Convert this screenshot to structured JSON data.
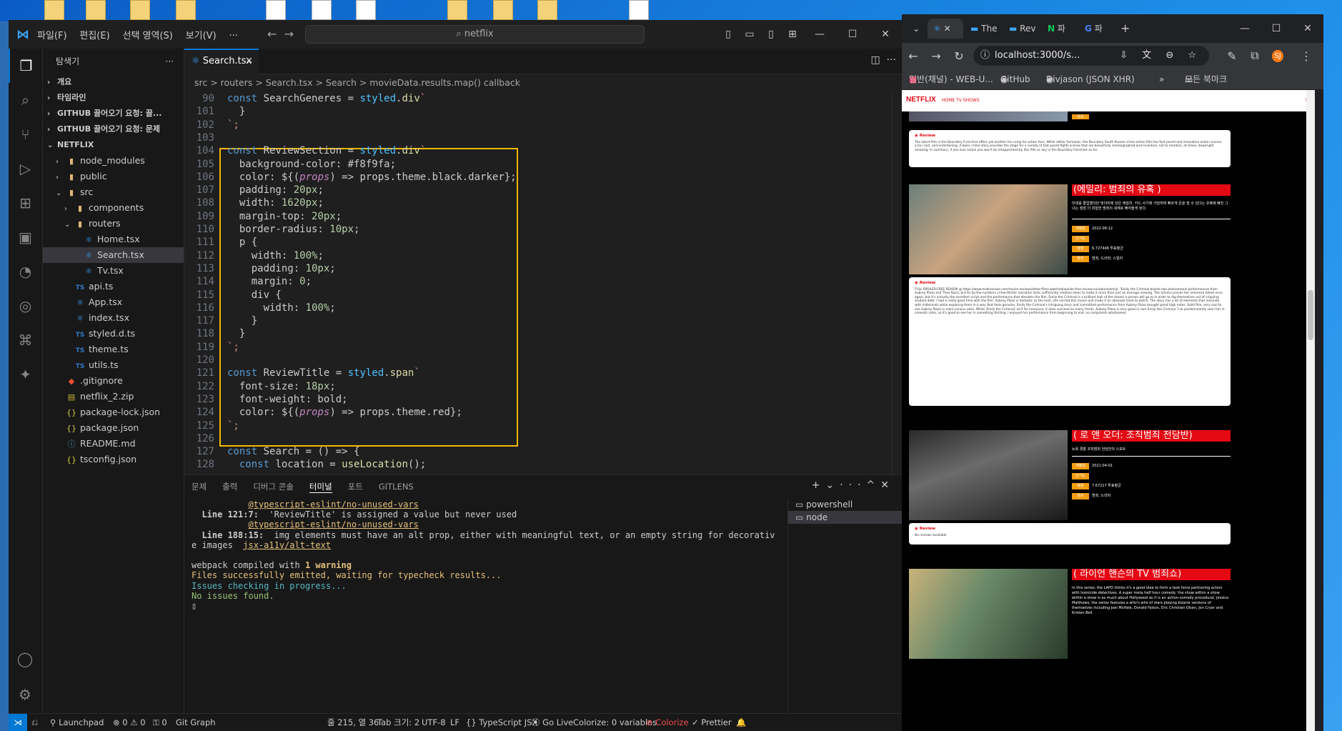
{
  "vscode": {
    "menu": [
      "파일(F)",
      "편집(E)",
      "선택 영역(S)",
      "보기(V)",
      "···"
    ],
    "command_center": "netflix",
    "explorer": {
      "title": "탐색기",
      "items": [
        {
          "label": "개요",
          "kind": "section"
        },
        {
          "label": "타임라인",
          "kind": "section"
        },
        {
          "label": "GITHUB 끌어오기 요청: 끌...",
          "kind": "section"
        },
        {
          "label": "GITHUB 끌어오기 요청: 문제",
          "kind": "section"
        },
        {
          "label": "NETFLIX",
          "kind": "section-open"
        },
        {
          "label": "node_modules",
          "kind": "folder"
        },
        {
          "label": "public",
          "kind": "folder"
        },
        {
          "label": "src",
          "kind": "folder-open"
        },
        {
          "label": "components",
          "kind": "folder"
        },
        {
          "label": "routers",
          "kind": "folder-open"
        },
        {
          "label": "Home.tsx",
          "kind": "tsx"
        },
        {
          "label": "Search.tsx",
          "kind": "tsx",
          "selected": true
        },
        {
          "label": "Tv.tsx",
          "kind": "tsx"
        },
        {
          "label": "api.ts",
          "kind": "ts"
        },
        {
          "label": "App.tsx",
          "kind": "tsx"
        },
        {
          "label": "index.tsx",
          "kind": "tsx"
        },
        {
          "label": "styled.d.ts",
          "kind": "ts"
        },
        {
          "label": "theme.ts",
          "kind": "ts"
        },
        {
          "label": "utils.ts",
          "kind": "ts"
        },
        {
          "label": ".gitignore",
          "kind": "git"
        },
        {
          "label": "netflix_2.zip",
          "kind": "zip"
        },
        {
          "label": "package-lock.json",
          "kind": "json"
        },
        {
          "label": "package.json",
          "kind": "json"
        },
        {
          "label": "README.md",
          "kind": "md"
        },
        {
          "label": "tsconfig.json",
          "kind": "json"
        }
      ]
    },
    "tab": {
      "label": "Search.tsx"
    },
    "breadcrumb": "src  >  routers  >  Search.tsx  >  Search  >  movieData.results.map() callback",
    "code": [
      {
        "n": "90",
        "t": "const SearchGeneres = styled.div`"
      },
      {
        "n": "101",
        "t": "  }"
      },
      {
        "n": "102",
        "t": "`;"
      },
      {
        "n": "103",
        "t": ""
      },
      {
        "n": "104",
        "t": "const ReviewSection = styled.div`"
      },
      {
        "n": "105",
        "t": "  background-color: #f8f9fa;"
      },
      {
        "n": "106",
        "t": "  color: ${(props) => props.theme.black.darker};"
      },
      {
        "n": "107",
        "t": "  padding: 20px;"
      },
      {
        "n": "108",
        "t": "  width: 1620px;"
      },
      {
        "n": "109",
        "t": "  margin-top: 20px;"
      },
      {
        "n": "110",
        "t": "  border-radius: 10px;"
      },
      {
        "n": "111",
        "t": "  p {"
      },
      {
        "n": "112",
        "t": "    width: 100%;"
      },
      {
        "n": "113",
        "t": "    padding: 10px;"
      },
      {
        "n": "114",
        "t": "    margin: 0;"
      },
      {
        "n": "115",
        "t": "    div {"
      },
      {
        "n": "116",
        "t": "      width: 100%;"
      },
      {
        "n": "117",
        "t": "    }"
      },
      {
        "n": "118",
        "t": "  }"
      },
      {
        "n": "119",
        "t": "`;"
      },
      {
        "n": "120",
        "t": ""
      },
      {
        "n": "121",
        "t": "const ReviewTitle = styled.span`"
      },
      {
        "n": "122",
        "t": "  font-size: 18px;"
      },
      {
        "n": "123",
        "t": "  font-weight: bold;"
      },
      {
        "n": "124",
        "t": "  color: ${(props) => props.theme.red};"
      },
      {
        "n": "125",
        "t": "`;"
      },
      {
        "n": "126",
        "t": ""
      },
      {
        "n": "127",
        "t": "const Search = () => {"
      },
      {
        "n": "128",
        "t": "  const location = useLocation();"
      }
    ],
    "panel_tabs": [
      "문제",
      "출력",
      "디버그 콘솔",
      "터미널",
      "포트",
      "GITLENS"
    ],
    "terminal": {
      "rule1": "@typescript-eslint/no-unused-vars",
      "line1_loc": "Line 121:7:",
      "line1_msg": "  'ReviewTitle' is assigned a value but never used",
      "rule2": "@typescript-eslint/no-unused-vars",
      "line2_loc": "Line 188:15:",
      "line2_msg": "  img elements must have an alt prop, either with meaningful text, or an empty string for decorativ",
      "line2_cont": "e images",
      "rule3": "jsx-a11y/alt-text",
      "webpack": "webpack compiled with ",
      "warning": "1 warning",
      "emitted": "Files successfully emitted, waiting for typecheck results...",
      "checking": "Issues checking in progress...",
      "none": "No issues found."
    },
    "terminal_list": [
      "powershell",
      "node"
    ],
    "status": {
      "launchpad": "Launchpad",
      "problems": "0 ⚠ 0",
      "ports": "0",
      "git_graph": "Git Graph",
      "cursor": "줄 215, 열 36",
      "tab_size": "Tab 크기: 2",
      "encoding": "UTF-8",
      "eol": "LF",
      "language": "TypeScript JSX",
      "golive": "Go Live",
      "colorize_vars": "Colorize: 0 variables",
      "colorize": "Colorize",
      "prettier": "Prettier"
    }
  },
  "chrome": {
    "tabs": [
      "The",
      "Rev",
      "파",
      "파"
    ],
    "url": "localhost:3000/s...",
    "bookmarks": [
      "일반(채널) - WEB-U...",
      "GitHub",
      "Divjason (JSON XHR)",
      "모든 북마크"
    ],
    "avatar": "SJ",
    "page": {
      "logo": "NETFLIX",
      "nav": "HOME   TV SHOWS",
      "movies": [
        {
          "title": "(에밀리: 범죄의 유혹 )",
          "overview": "미대를 졸업했지만 빚더미에 앉은 에밀리. 카드 사기에 가담하며 빠르게 돈을 벌 수 있다는 유혹에 빠진 그녀는 점점 더 위험한 범죄의 세계로 빠져들게 된다.",
          "labels": [
            "개봉일",
            "인기도",
            "평점",
            "장르"
          ],
          "values": [
            "2022-08-12",
            "",
            "6.727448 투표평균",
            "범죄, 드라마, 스릴러"
          ]
        },
        {
          "title": "( 로 앤 오더: 조직범죄 전담반)",
          "overview": "뉴욕 경찰 조직범죄 전담반의 스포트",
          "labels": [
            "개봉일",
            "인기도",
            "평점",
            "장르"
          ],
          "values": [
            "2021-04-01",
            "",
            "7.67217 투표평균",
            "범죄, 드라마"
          ]
        },
        {
          "title": "( 라이언 핸슨의 TV 범죄쇼)",
          "overview": "In this series, the LAPD thinks it's a good idea to form a task force partnering actors with homicide detectives. A super meta half hour comedy, the show within a show within a show is as much about Hollywood as it is an action-comedy procedural. Jessica Matthews, the series features a who's who of stars playing bizarre versions of themselves including Joel McHale, Donald Faison, Eric Christian Olsen, Jon Cryer and Kristen Bell.",
          "labels": [],
          "values": []
        }
      ],
      "reviews": [
        {
          "label": "Review",
          "text": "The latest film in the Boundary Franchise offers yet another fun romp for action fans. While rather formulaic, the Boundary South Korean crime action film has fast paced and innovative action scenes, a fun cast, and entertaining. A basic crime story provides the stage for a variety of fast paced fights scenes that are beautifully choreographed and inventive, not to mention, at times, downright amazing. In summary, if you love action you won't be disappointed by this film or any in the Boundary franchise so far."
        },
        {
          "label": "Review",
          "text": "FULL SPOILER-FREE REVIEW @ https://www.msbreviews.com/movie-reviews/other-films-watched/spoiler-free-review-sundance/emily: \"Emily the Criminal boasts two phenomenal performances from Aubrey Plaza and Theo Rossi, but its by-the-numbers crime-thriller narrative lacks sufficiently creative ideas to make it more than just an average viewing. The actress proves her immense talent once again, but it's actually the excellent script and the performance that elevates the film. Emily the Criminal is a brilliant look at the dream a person will go to in order to dig themselves out of crippling student debt. I had a really good time with the film. Aubrey Plaza is fantastic as the lead, she carried this movie and made it an absolute treat to watch. The story has a lot of elements that resonate with millennials while exploring them in a way that feels genuine. Emily the Criminal's intriguing story and committed performance from Aubrey Plaza brought great high notes. Solid film, very cool to see Aubrey Plaza in more serious roles. While 'Emily the Criminal' isn't for everyone, it does succeed on many fronts. Aubrey Plaza is very good in rare Emily the Criminal. I've predominantly seen her in comedic roles, so it's good to see her in something thrilling. I enjoyed her performance from beginning to end, no complaints whatsoever."
        },
        {
          "label": "Review",
          "text": "No reviews available"
        }
      ]
    }
  }
}
